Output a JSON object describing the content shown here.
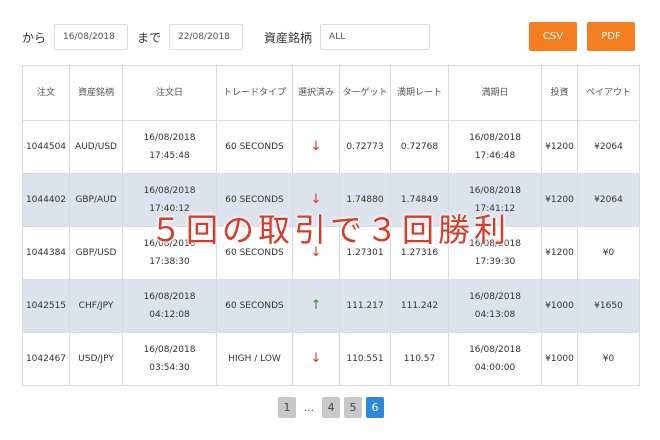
{
  "filter": {
    "from_label": "から",
    "from_value": "16/08/2018",
    "to_label": "まで",
    "to_value": "22/08/2018",
    "asset_label": "資産銘柄",
    "asset_value": "ALL",
    "csv_label": "CSV",
    "pdf_label": "PDF"
  },
  "table": {
    "headers": [
      "注文",
      "資産銘柄",
      "注文日",
      "トレードタイプ",
      "選択済み",
      "ターゲット",
      "満期レート",
      "満期日",
      "投資",
      "ペイアウト"
    ],
    "rows": [
      {
        "id": "1044504",
        "asset": "AUD/USD",
        "date": "16/08/2018",
        "time": "17:45:48",
        "type": "60 SECONDS",
        "dir": "↓",
        "target": "0.72773",
        "rate": "0.72768",
        "exp_date": "16/08/2018",
        "exp_time": "17:46:48",
        "invest": "¥1200",
        "payout": "¥2064"
      },
      {
        "id": "1044402",
        "asset": "GBP/AUD",
        "date": "16/08/2018",
        "time": "17:40:12",
        "type": "60 SECONDS",
        "dir": "↓",
        "target": "1.74880",
        "rate": "1.74849",
        "exp_date": "16/08/2018",
        "exp_time": "17:41:12",
        "invest": "¥1200",
        "payout": "¥2064"
      },
      {
        "id": "1044384",
        "asset": "GBP/USD",
        "date": "16/08/2018",
        "time": "17:38:30",
        "type": "60 SECONDS",
        "dir": "↓",
        "target": "1.27301",
        "rate": "1.27316",
        "exp_date": "16/08/2018",
        "exp_time": "17:39:30",
        "invest": "¥1200",
        "payout": "¥0"
      },
      {
        "id": "1042515",
        "asset": "CHF/JPY",
        "date": "16/08/2018",
        "time": "04:12:08",
        "type": "60 SECONDS",
        "dir": "↑",
        "target": "111.217",
        "rate": "111.242",
        "exp_date": "16/08/2018",
        "exp_time": "04:13:08",
        "invest": "¥1000",
        "payout": "¥1650"
      },
      {
        "id": "1042467",
        "asset": "USD/JPY",
        "date": "16/08/2018",
        "time": "03:54:30",
        "type": "HIGH / LOW",
        "dir": "↓",
        "target": "110.551",
        "rate": "110.57",
        "exp_date": "16/08/2018",
        "exp_time": "04:00:00",
        "invest": "¥1000",
        "payout": "¥0"
      }
    ]
  },
  "pagination": {
    "first": "1",
    "ellipsis": "...",
    "p4": "4",
    "p5": "5",
    "current": "6"
  },
  "overlay_caption": "５回の取引で３回勝利",
  "colors": {
    "accent_button": "#f57f20",
    "active_page": "#2d8ad8",
    "arrow_down": "#e03028",
    "arrow_up": "#3a8a3a",
    "caption": "#d93c2a"
  }
}
